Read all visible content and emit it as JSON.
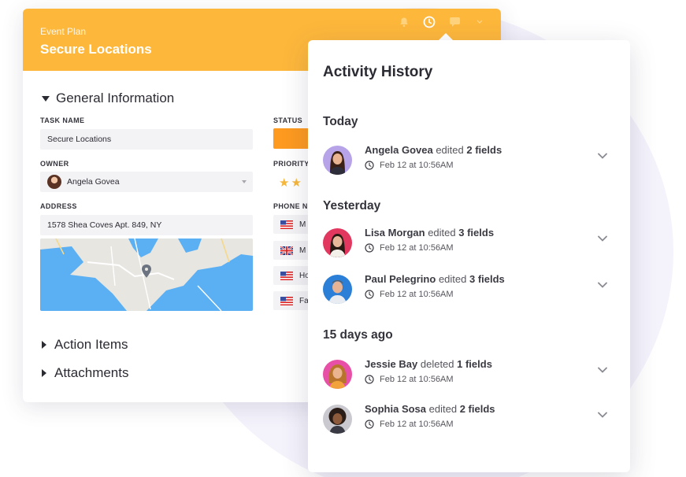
{
  "card": {
    "breadcrumb": "Event Plan",
    "title": "Secure Locations",
    "section_general": "General Information",
    "fields": {
      "task_name_label": "TASK NAME",
      "task_name_value": "Secure Locations",
      "owner_label": "OWNER",
      "owner_value": "Angela Govea",
      "address_label": "ADDRESS",
      "address_value": "1578 Shea Coves Apt. 849, NY",
      "status_label": "STATUS",
      "priority_label": "PRIORITY",
      "priority_stars_visible": 2,
      "phone_label": "PHONE N",
      "phones": [
        {
          "flag": "us",
          "text": "M"
        },
        {
          "flag": "uk",
          "text": "M"
        },
        {
          "flag": "us",
          "text": "Ho"
        },
        {
          "flag": "us",
          "text": "Fa"
        }
      ]
    },
    "section_action_items": "Action Items",
    "section_attachments": "Attachments",
    "header_icons": [
      "bell-icon",
      "clock-icon",
      "chat-icon",
      "chevron-down-icon"
    ],
    "colors": {
      "header": "#fdb73b",
      "status": "#fd9a1f",
      "star": "#f6b73c"
    }
  },
  "panel": {
    "title": "Activity History",
    "groups": [
      {
        "title": "Today",
        "entries": [
          {
            "name": "Angela Govea",
            "action": "edited",
            "count": "2 fields",
            "time": "Feb 12 at 10:56AM",
            "avatar_bg": "#b6a3e8"
          }
        ]
      },
      {
        "title": "Yesterday",
        "entries": [
          {
            "name": "Lisa Morgan",
            "action": "edited",
            "count": "3 fields",
            "time": "Feb 12 at 10:56AM",
            "avatar_bg": "#e2375f"
          },
          {
            "name": "Paul Pelegrino",
            "action": "edited",
            "count": "3 fields",
            "time": "Feb 12 at 10:56AM",
            "avatar_bg": "#2b7fd6"
          }
        ]
      },
      {
        "title": "15 days ago",
        "entries": [
          {
            "name": "Jessie Bay",
            "action": "deleted",
            "count": "1 fields",
            "time": "Feb 12 at 10:56AM",
            "avatar_bg": "#e84fa6"
          },
          {
            "name": "Sophia Sosa",
            "action": "edited",
            "count": "2 fields",
            "time": "Feb 12 at 10:56AM",
            "avatar_bg": "#c9c9cf"
          }
        ]
      }
    ]
  }
}
